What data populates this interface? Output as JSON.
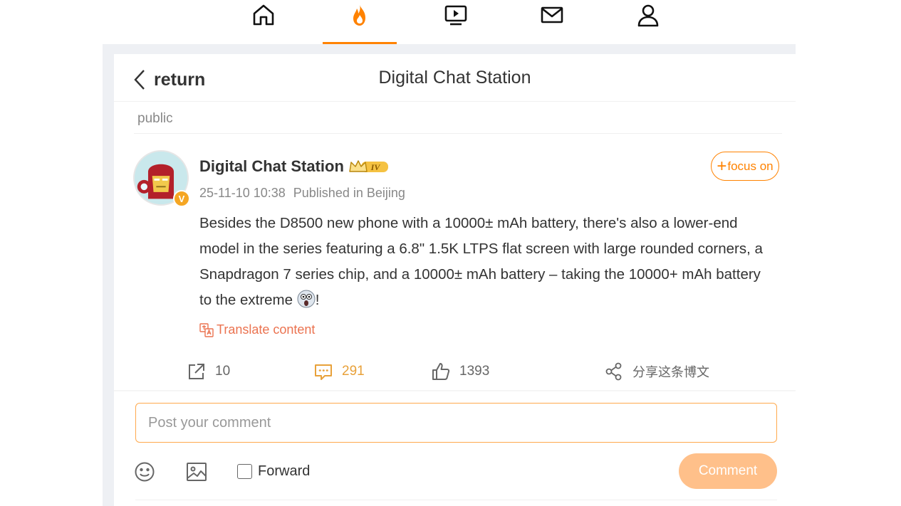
{
  "nav": {
    "items": [
      {
        "icon": "home-icon"
      },
      {
        "icon": "fire-icon",
        "active": true
      },
      {
        "icon": "video-icon"
      },
      {
        "icon": "mail-icon"
      },
      {
        "icon": "profile-icon"
      }
    ],
    "accent": "#ff8200"
  },
  "header": {
    "back_label": "return",
    "title": "Digital Chat Station"
  },
  "visibility": "public",
  "post": {
    "author": "Digital Chat Station",
    "level_badge": "IV",
    "verified_mark": "V",
    "timestamp": "25-11-10 10:38",
    "location": "Published in Beijing",
    "follow_label": "focus on",
    "text": "Besides the D8500 new phone with a 10000± mAh battery, there's also a lower-end model in the series featuring a 6.8\" 1.5K LTPS flat screen with large rounded corners, a Snapdragon 7 series chip, and a 10000± mAh battery – taking the 10000+ mAh battery to the extreme",
    "text_end": "!",
    "translate_label": "Translate content",
    "reposts": "10",
    "comments": "291",
    "likes": "1393",
    "share_label": "分享这条博文"
  },
  "composer": {
    "placeholder": "Post your comment",
    "forward_label": "Forward",
    "comment_button": "Comment"
  },
  "colors": {
    "accent": "#ff8200",
    "link": "#eb7350",
    "comment_count": "#e8a13a",
    "button_disabled": "#ffc08a"
  }
}
